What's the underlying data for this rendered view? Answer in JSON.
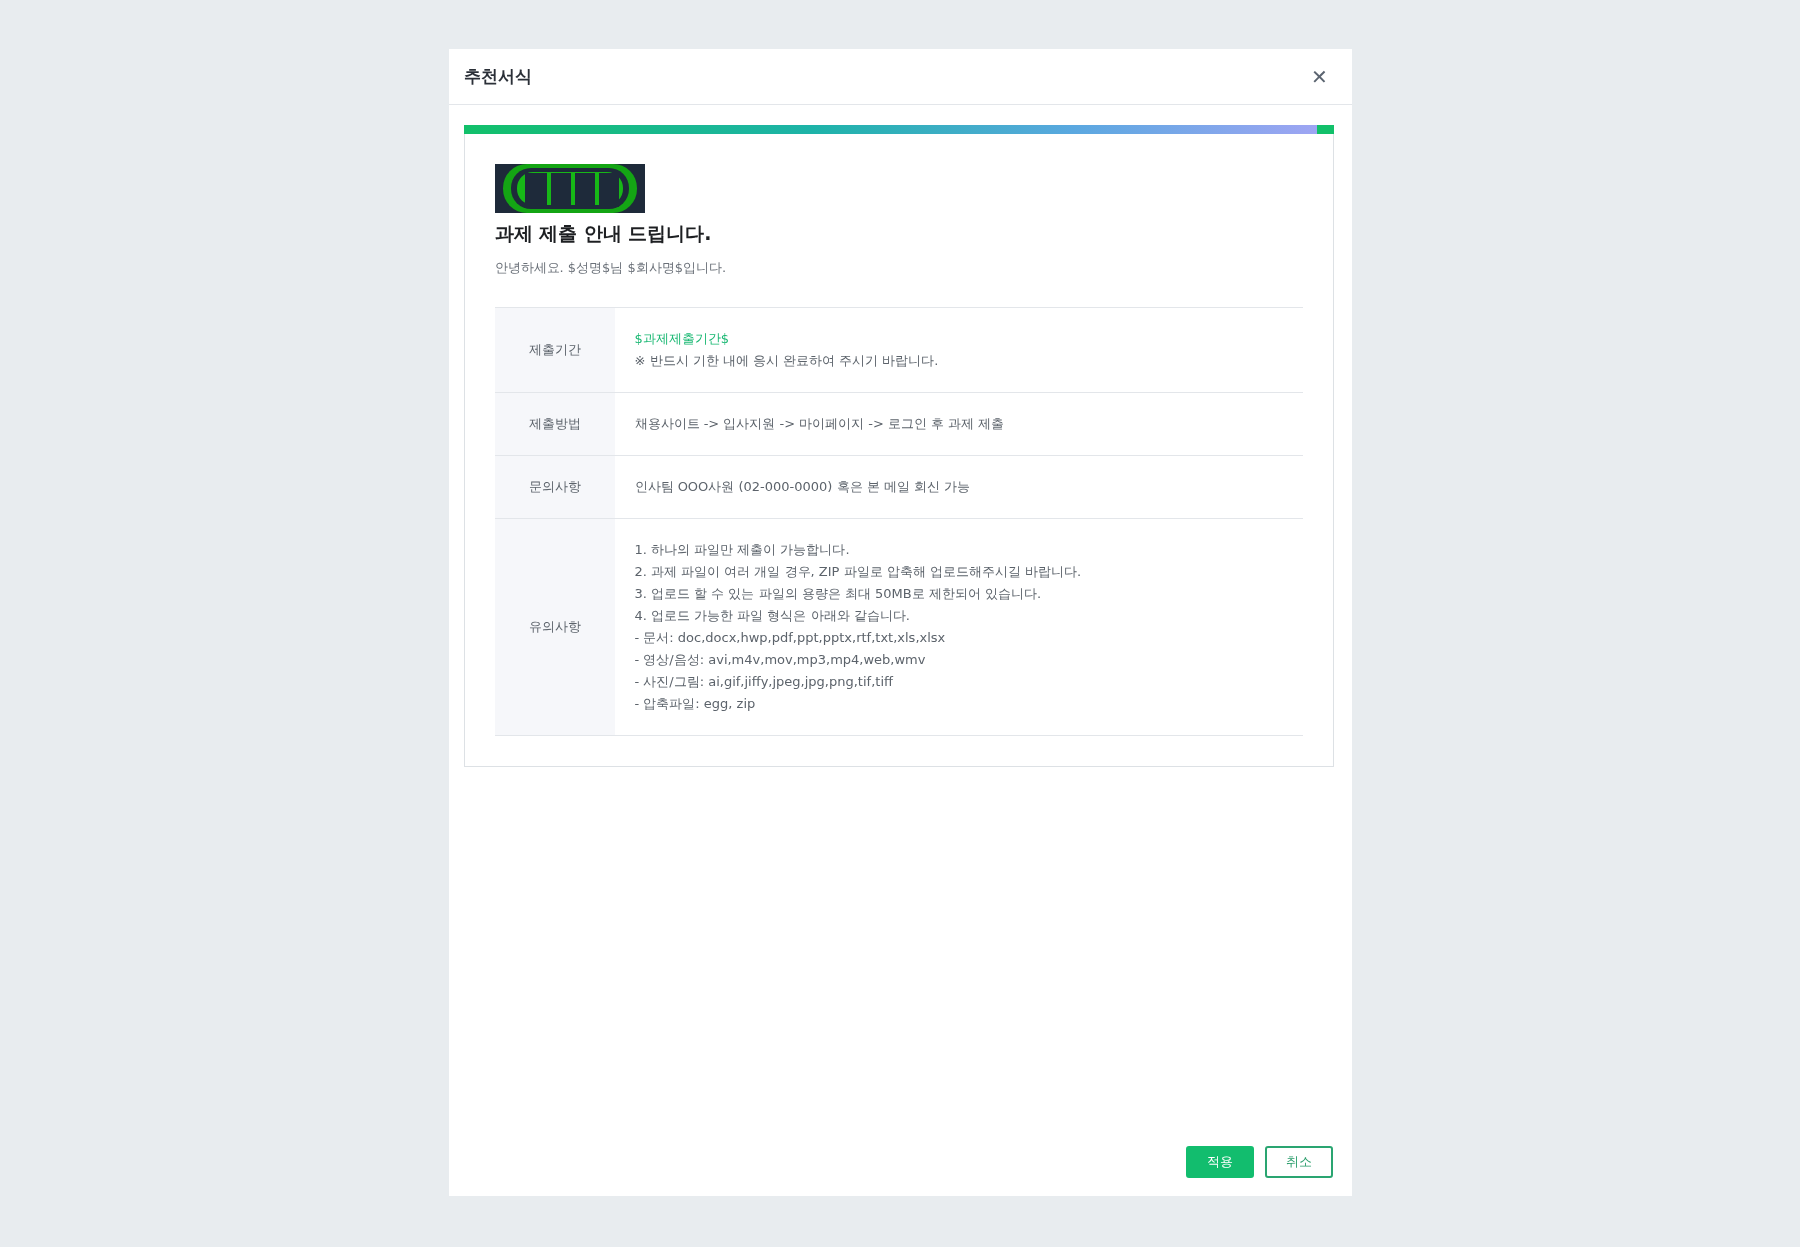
{
  "dialog": {
    "title": "추천서식",
    "close": "✕"
  },
  "template": {
    "heading": "과제 제출 안내 드립니다.",
    "greeting": "안녕하세요. $성명$님 $회사명$입니다.",
    "rows": [
      {
        "label": "제출기간",
        "lines": [
          {
            "text": "$과제제출기간$",
            "kind": "variable"
          },
          {
            "text": "※ 반드시 기한 내에 응시 완료하여 주시기 바랍니다.",
            "kind": "plain"
          }
        ]
      },
      {
        "label": "제출방법",
        "lines": [
          {
            "text": "채용사이트 -> 입사지원 -> 마이페이지 -> 로그인 후 과제 제출",
            "kind": "plain"
          }
        ]
      },
      {
        "label": "문의사항",
        "lines": [
          {
            "text": "인사팀 OOO사원 (02-000-0000) 혹은 본 메일 회신 가능",
            "kind": "plain"
          }
        ]
      },
      {
        "label": "유의사항",
        "lines": [
          {
            "text": "1. 하나의 파일만 제출이 가능합니다.",
            "kind": "plain"
          },
          {
            "text": "2. 과제 파일이 여러 개일 경우, ZIP 파일로 압축해 업로드해주시길 바랍니다.",
            "kind": "plain"
          },
          {
            "text": "3. 업로드 할 수 있는 파일의 용량은 최대 50MB로 제한되어 있습니다.",
            "kind": "plain"
          },
          {
            "text": "4. 업로드 가능한 파일 형식은 아래와 같습니다.",
            "kind": "plain"
          },
          {
            "text": "- 문서: doc,docx,hwp,pdf,ppt,pptx,rtf,txt,xls,xlsx",
            "kind": "plain"
          },
          {
            "text": "- 영상/음성: avi,m4v,mov,mp3,mp4,web,wmv",
            "kind": "plain"
          },
          {
            "text": "- 사진/그림: ai,gif,jiffy,jpeg,jpg,png,tif,tiff",
            "kind": "plain"
          },
          {
            "text": "- 압축파일: egg, zip",
            "kind": "plain"
          }
        ]
      }
    ]
  },
  "buttons": [
    {
      "label": "적용",
      "kind": "primary"
    },
    {
      "label": "취소",
      "kind": "secondary"
    }
  ]
}
